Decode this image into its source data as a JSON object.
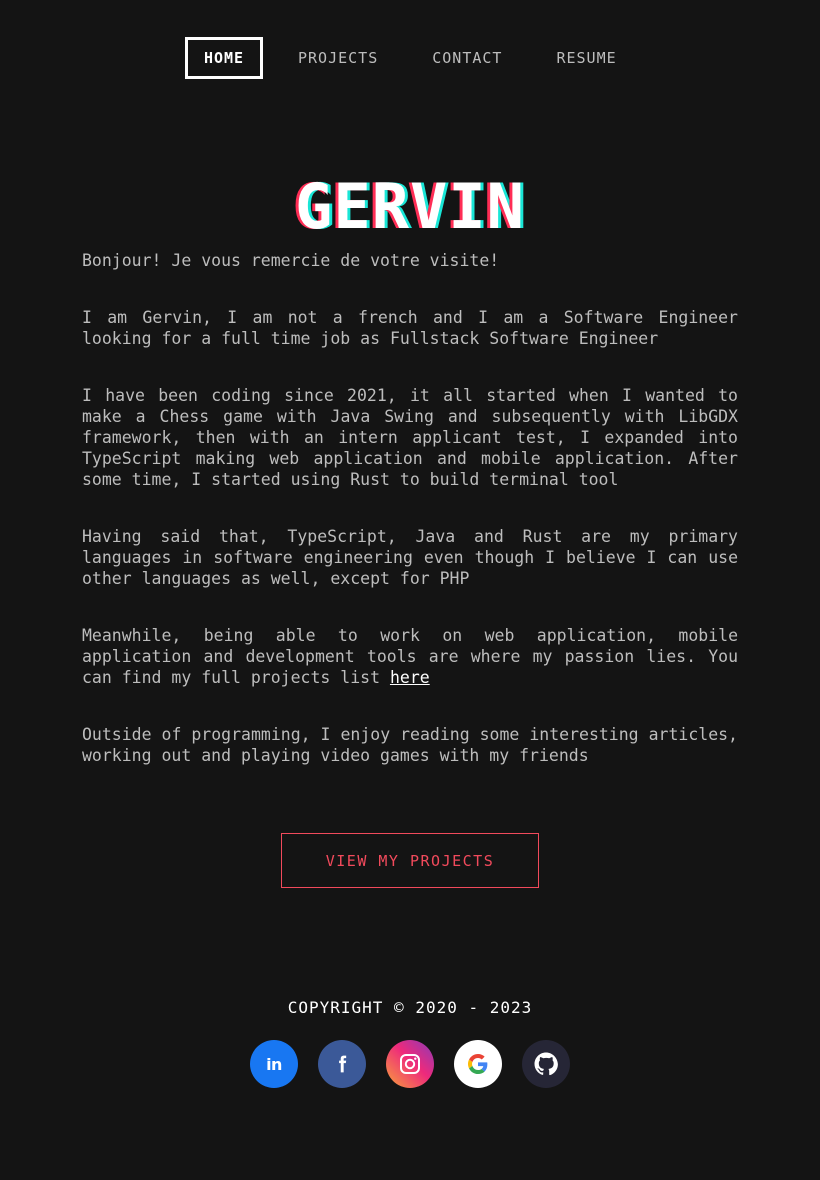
{
  "nav": {
    "items": [
      {
        "label": "HOME",
        "active": true
      },
      {
        "label": "PROJECTS",
        "active": false
      },
      {
        "label": "CONTACT",
        "active": false
      },
      {
        "label": "RESUME",
        "active": false
      }
    ]
  },
  "hero": {
    "title": "GERVIN"
  },
  "content": {
    "p1": "Bonjour! Je vous remercie de votre visite!",
    "p2": "I am Gervin, I am not a french and I am a Software Engineer looking for a full time job as Fullstack Software Engineer",
    "p3": "I have been coding since 2021, it all started when I wanted to make a Chess game with Java Swing and subsequently with LibGDX framework, then with an intern applicant test, I expanded into TypeScript making web application and mobile application. After some time, I started using Rust to build terminal tool",
    "p4": "Having said that, TypeScript, Java and Rust are my primary languages in software engineering even though I believe I can use other languages as well, except for PHP",
    "p5_text": "Meanwhile, being able to work on web application, mobile application and development tools are where my passion lies. You can find my full projects list ",
    "p5_link": "here",
    "p6": "Outside of programming, I enjoy reading some interesting articles, working out and playing video games with my friends"
  },
  "cta": {
    "label": "VIEW MY PROJECTS"
  },
  "footer": {
    "copyright": "COPYRIGHT © 2020 - 2023",
    "linkedin_glyph": "in",
    "socials": [
      {
        "icon": "linkedin-icon",
        "color": "#1877f2"
      },
      {
        "icon": "facebook-icon",
        "color": "#3b5998"
      },
      {
        "icon": "instagram-icon",
        "color": "#e1306c"
      },
      {
        "icon": "google-icon",
        "color": "#ffffff"
      },
      {
        "icon": "github-icon",
        "color": "#262636"
      }
    ]
  },
  "colors": {
    "background": "#141414",
    "text": "#bdbdbd",
    "accent": "#f24a5c",
    "title_shadow_red": "#ff2d55",
    "title_shadow_cyan": "#19e6d6"
  }
}
